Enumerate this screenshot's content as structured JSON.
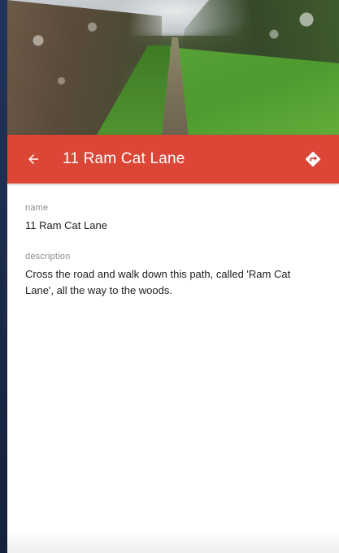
{
  "header": {
    "title": "11 Ram Cat Lane",
    "back_icon": "arrow-left-icon",
    "directions_icon": "directions-icon",
    "bar_color": "#dc4636"
  },
  "hero": {
    "alt": "rural path between hedgerows"
  },
  "details": {
    "name_label": "name",
    "name_value": "11 Ram Cat Lane",
    "description_label": "description",
    "description_value": "Cross the road and walk down this path, called 'Ram Cat Lane', all the way to the woods."
  }
}
